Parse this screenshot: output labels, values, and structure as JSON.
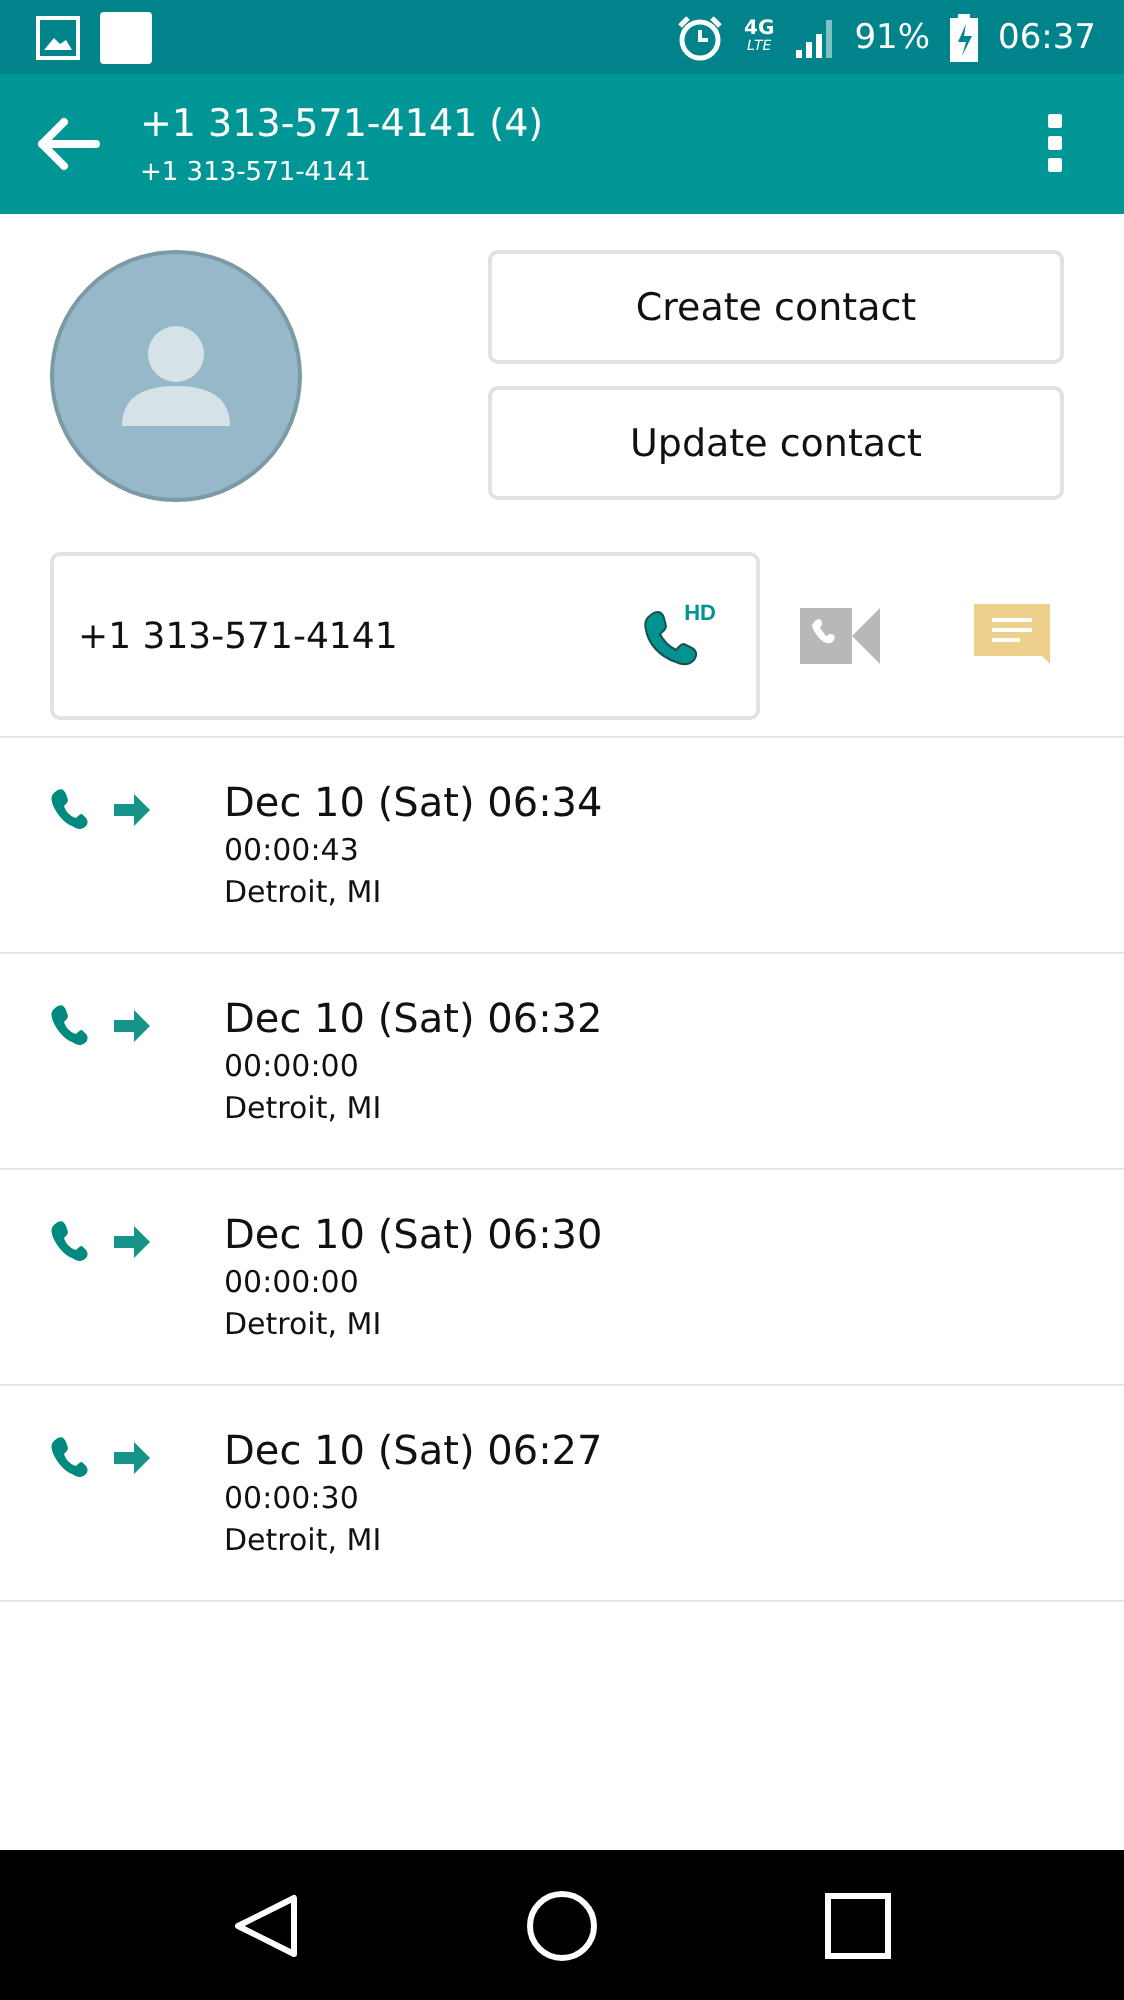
{
  "status_bar": {
    "battery": "91%",
    "time": "06:37",
    "network": "4G",
    "network_sub": "LTE"
  },
  "app_bar": {
    "title": "+1 313-571-4141 (4)",
    "subtitle": "+1 313-571-4141"
  },
  "actions": [
    "Create contact",
    "Update contact"
  ],
  "phone": {
    "number": "+1 313-571-4141",
    "badge": "HD"
  },
  "calls": [
    {
      "kind": "outgoing",
      "date": "Dec 10 (Sat) 06:34",
      "duration": "00:00:43",
      "location": "Detroit, MI"
    },
    {
      "kind": "outgoing",
      "date": "Dec 10 (Sat) 06:32",
      "duration": "00:00:00",
      "location": "Detroit, MI"
    },
    {
      "kind": "outgoing",
      "date": "Dec 10 (Sat) 06:30",
      "duration": "00:00:00",
      "location": "Detroit, MI"
    },
    {
      "kind": "outgoing",
      "date": "Dec 10 (Sat) 06:27",
      "duration": "00:00:30",
      "location": "Detroit, MI"
    }
  ]
}
